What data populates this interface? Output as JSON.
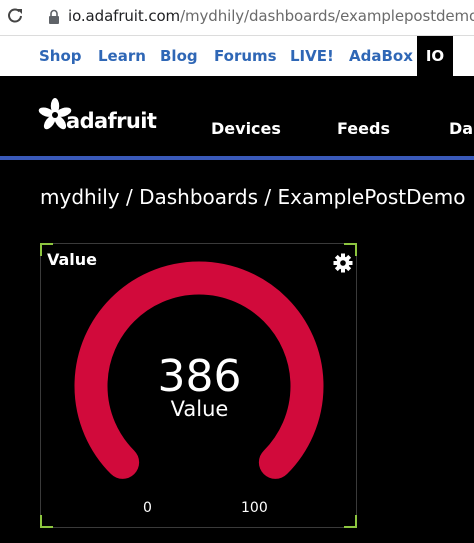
{
  "browser": {
    "url_host": "io.adafruit.com",
    "url_path": "/mydhily/dashboards/examplepostdemo"
  },
  "topnav": {
    "items": [
      "Shop",
      "Learn",
      "Blog",
      "Forums",
      "LIVE!",
      "AdaBox"
    ],
    "active": "IO"
  },
  "header": {
    "brand": "adafruit",
    "nav": [
      "Devices",
      "Feeds",
      "Das"
    ]
  },
  "breadcrumb": "mydhily / Dashboards / ExamplePostDemo",
  "gauge": {
    "title": "Value",
    "value": "386",
    "label": "Value",
    "min": "0",
    "max": "100",
    "fill_fraction": 1.0,
    "color": "#d10a3b"
  },
  "colors": {
    "link": "#2f67b6",
    "rule": "#3959b9",
    "corner": "#8dc63f"
  }
}
